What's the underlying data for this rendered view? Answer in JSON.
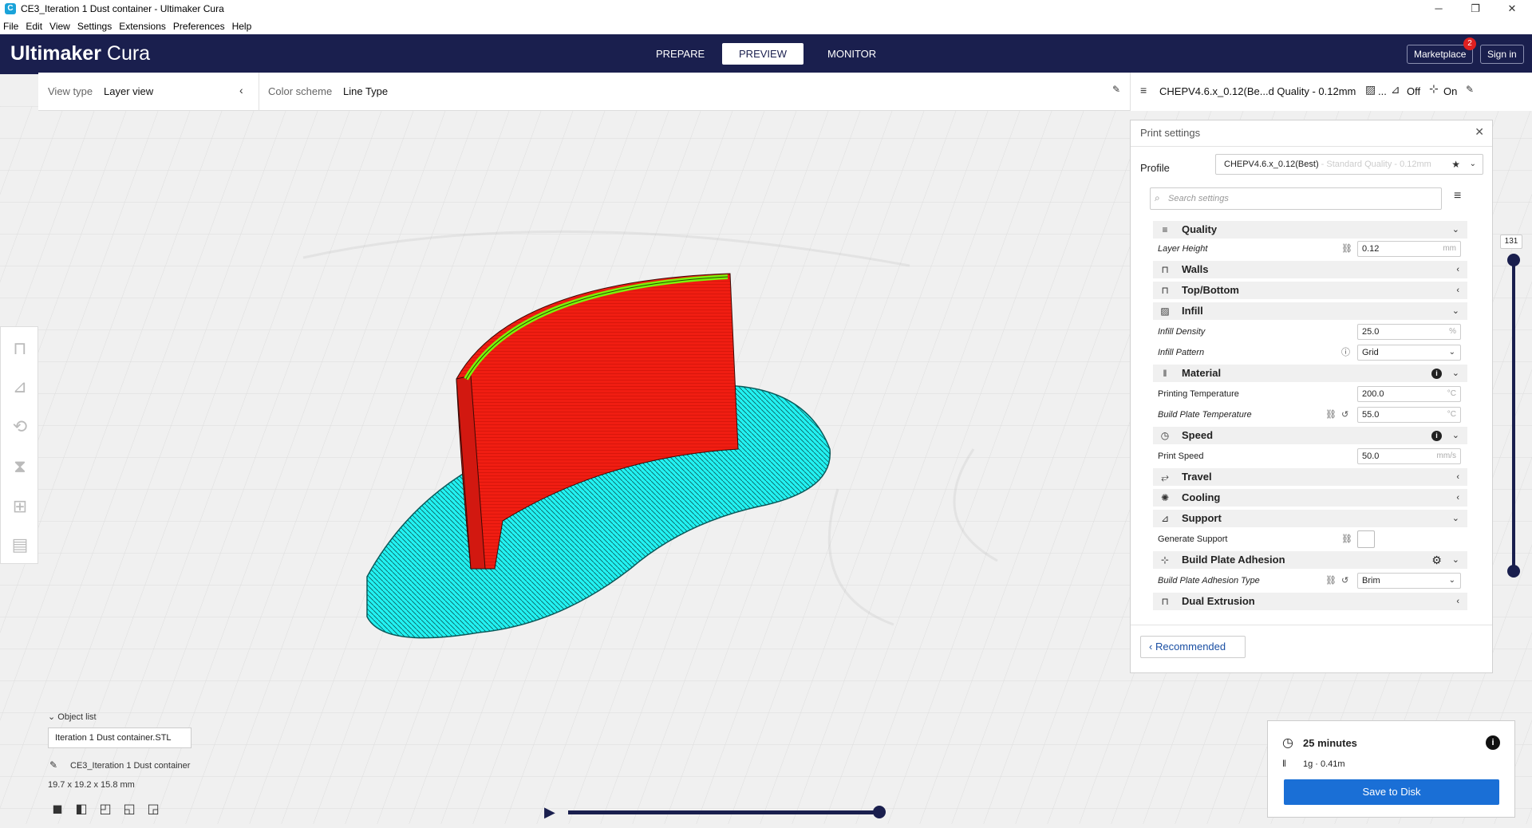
{
  "window": {
    "title": "CE3_Iteration 1 Dust container - Ultimaker Cura",
    "app_icon": "C",
    "controls": [
      "─",
      "❐",
      "✕"
    ]
  },
  "menu": [
    {
      "label": "File"
    },
    {
      "label": "Edit"
    },
    {
      "label": "View"
    },
    {
      "label": "Settings"
    },
    {
      "label": "Extensions"
    },
    {
      "label": "Preferences"
    },
    {
      "label": "Help"
    }
  ],
  "header": {
    "logo_bold": "Ultimaker",
    "logo_light": " Cura",
    "tabs": [
      {
        "label": "PREPARE"
      },
      {
        "label": "PREVIEW"
      },
      {
        "label": "MONITOR"
      }
    ],
    "active_tab": "PREVIEW",
    "marketplace": "Marketplace",
    "marketplace_badge": "2",
    "signin": "Sign in",
    "bg_color": "#1a1f4e"
  },
  "viewbar": {
    "view_type_label": "View type",
    "view_type_value": "Layer view",
    "color_scheme_label": "Color scheme",
    "color_scheme_value": "Line Type"
  },
  "machinebar": {
    "profile": "CHEPV4.6.x_0.12(Be...d Quality - 0.12mm",
    "ellipsis": "...",
    "support": "Off",
    "adhesion": "On"
  },
  "print_settings": {
    "title": "Print settings",
    "profile_label": "Profile",
    "profile_value": "CHEPV4.6.x_0.12(Best)",
    "profile_suffix": " - Standard Quality - 0.12mm",
    "search_placeholder": "Search settings",
    "categories": {
      "quality": "Quality",
      "walls": "Walls",
      "topbottom": "Top/Bottom",
      "infill": "Infill",
      "material": "Material",
      "speed": "Speed",
      "travel": "Travel",
      "cooling": "Cooling",
      "support": "Support",
      "adhesion": "Build Plate Adhesion",
      "dual": "Dual Extrusion"
    },
    "settings": {
      "layer_height": {
        "label": "Layer Height",
        "value": "0.12",
        "unit": "mm"
      },
      "infill_density": {
        "label": "Infill Density",
        "value": "25.0",
        "unit": "%"
      },
      "infill_pattern": {
        "label": "Infill Pattern",
        "value": "Grid"
      },
      "print_temp": {
        "label": "Printing Temperature",
        "value": "200.0",
        "unit": "°C"
      },
      "bed_temp": {
        "label": "Build Plate Temperature",
        "value": "55.0",
        "unit": "°C"
      },
      "print_speed": {
        "label": "Print Speed",
        "value": "50.0",
        "unit": "mm/s"
      },
      "gen_support": {
        "label": "Generate Support"
      },
      "adhesion_type": {
        "label": "Build Plate Adhesion Type",
        "value": "Brim"
      }
    },
    "recommended": "Recommended"
  },
  "layer_slider": {
    "current": "131"
  },
  "objects": {
    "list_label": "Object list",
    "file": "Iteration 1 Dust container.STL",
    "name": "CE3_Iteration 1 Dust container",
    "dims": "19.7 x 19.2 x 15.8 mm"
  },
  "output": {
    "time": "25 minutes",
    "material": "1g · 0.41m",
    "save": "Save to Disk"
  }
}
